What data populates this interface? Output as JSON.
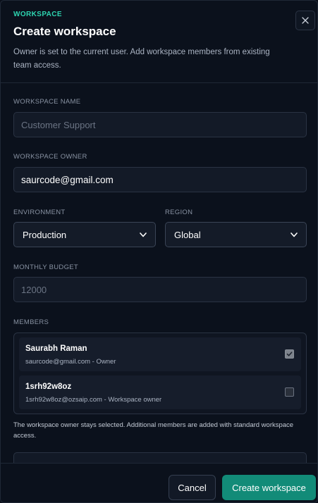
{
  "header": {
    "eyebrow": "WORKSPACE",
    "title": "Create workspace",
    "subtitle": "Owner is set to the current user. Add workspace members from existing team access.",
    "close_icon": "close-icon"
  },
  "form": {
    "name_label": "WORKSPACE NAME",
    "name_placeholder": "Customer Support",
    "name_value": "",
    "owner_label": "WORKSPACE OWNER",
    "owner_value": "saurcode@gmail.com",
    "environment_label": "ENVIRONMENT",
    "environment_value": "Production",
    "region_label": "REGION",
    "region_value": "Global",
    "budget_label": "MONTHLY BUDGET",
    "budget_placeholder": "12000",
    "members_label": "MEMBERS"
  },
  "members": [
    {
      "name": "Saurabh Raman",
      "detail": "saurcode@gmail.com - Owner",
      "checked": true
    },
    {
      "name": "1srh92w8oz",
      "detail": "1srh92w8oz@ozsaip.com - Workspace owner",
      "checked": false
    }
  ],
  "hint": "The workspace owner stays selected. Additional members are added with standard workspace access.",
  "footer": {
    "cancel_label": "Cancel",
    "submit_label": "Create workspace"
  },
  "colors": {
    "accent": "#2dd4b0",
    "primary_button": "#128b78",
    "background": "#0b111c"
  }
}
